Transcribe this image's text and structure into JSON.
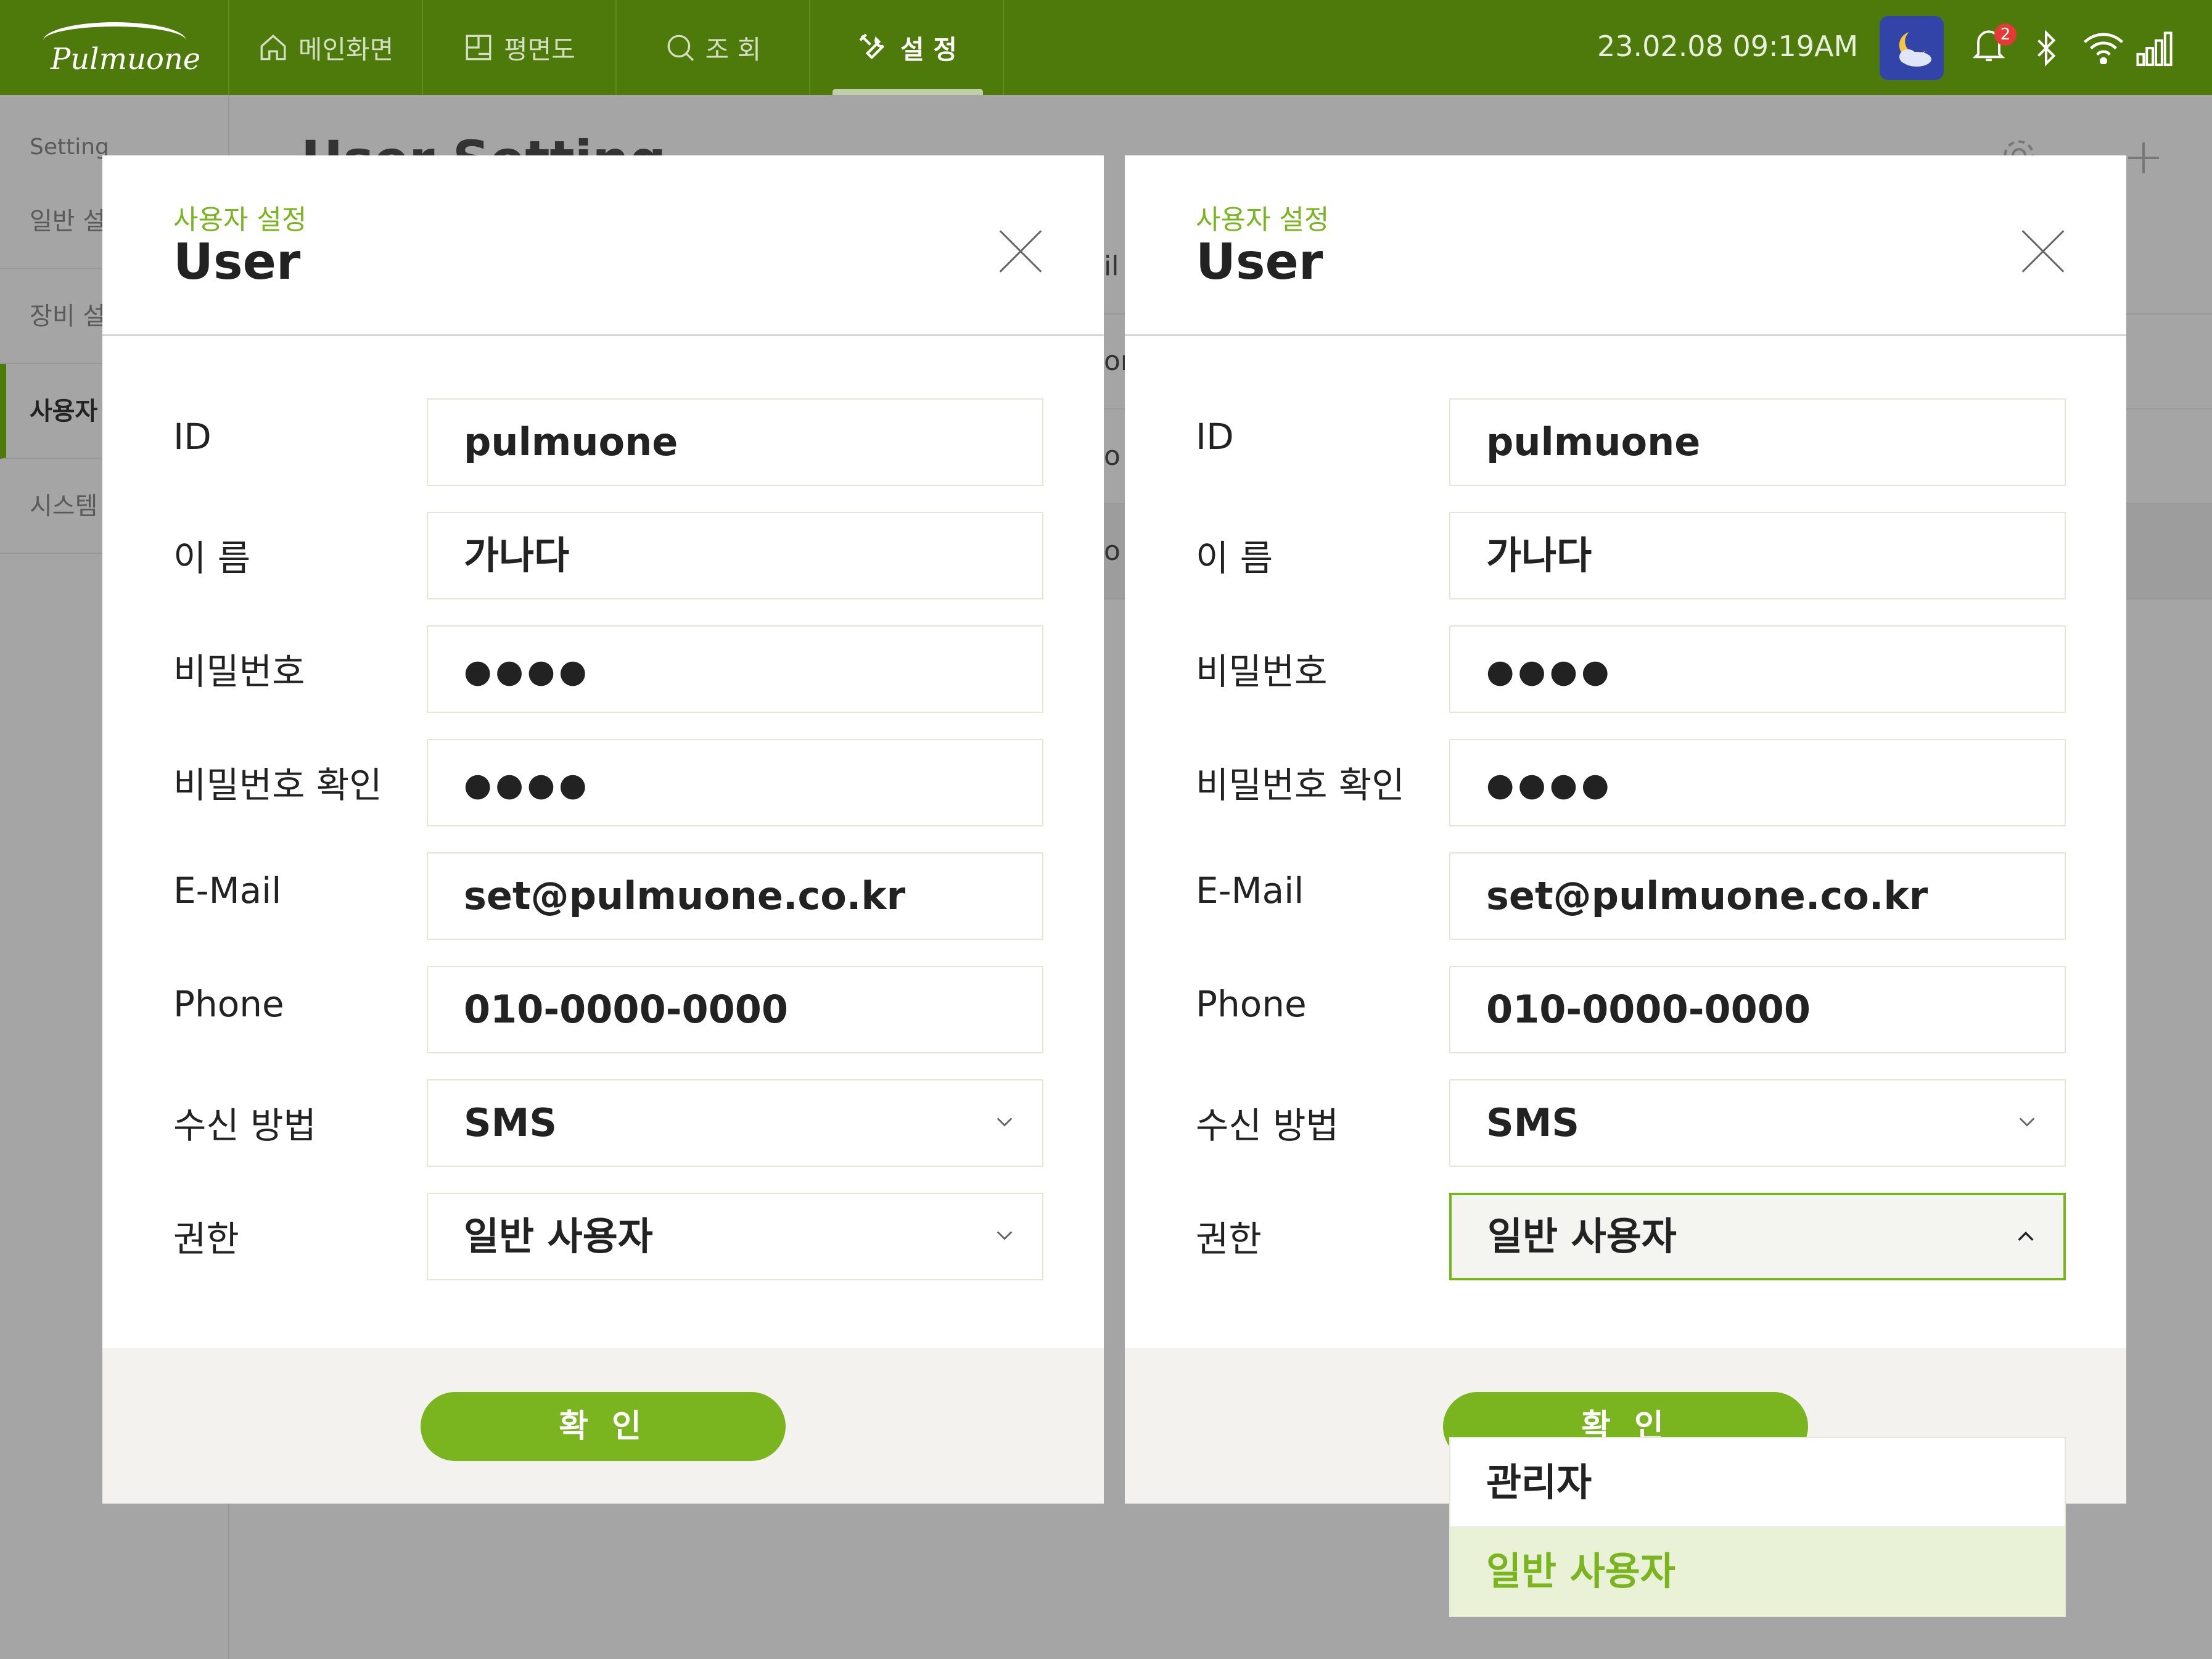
{
  "app": {
    "logo_text": "Pulmuone"
  },
  "nav": [
    {
      "label": "메인화면",
      "icon": "home-icon"
    },
    {
      "label": "평면도",
      "icon": "floorplan-icon"
    },
    {
      "label": "조 회",
      "icon": "search-icon"
    },
    {
      "label": "설 정",
      "icon": "tools-icon",
      "active": true
    }
  ],
  "status": {
    "datetime": "23.02.08  09:19AM",
    "notification_count": "2"
  },
  "background": {
    "title": "User Setting",
    "sidebar": [
      "Setting",
      "일반 설",
      "장비 설",
      "사용자",
      "시스템"
    ],
    "row_fragments": [
      "il",
      "or",
      "o",
      "o"
    ]
  },
  "modal": {
    "subtitle": "사용자 설정",
    "title": "User",
    "fields": {
      "id_label": "ID",
      "id_value": "pulmuone",
      "name_label": "이 름",
      "name_value": "가나다",
      "pw_label": "비밀번호",
      "pw_value": "●●●●",
      "pw2_label": "비밀번호 확인",
      "pw2_value": "●●●●",
      "email_label": "E-Mail",
      "email_value": "set@pulmuone.co.kr",
      "phone_label": "Phone",
      "phone_value": "010-0000-0000",
      "method_label": "수신 방법",
      "method_value": "SMS",
      "role_label": "권한",
      "role_value": "일반 사용자"
    },
    "confirm_label": "확 인"
  },
  "role_options": [
    "관리자",
    "일반 사용자"
  ],
  "colors": {
    "topbar": "#4d7a0a",
    "accent": "#7ab41e",
    "overlay": "#a5a5a5"
  }
}
